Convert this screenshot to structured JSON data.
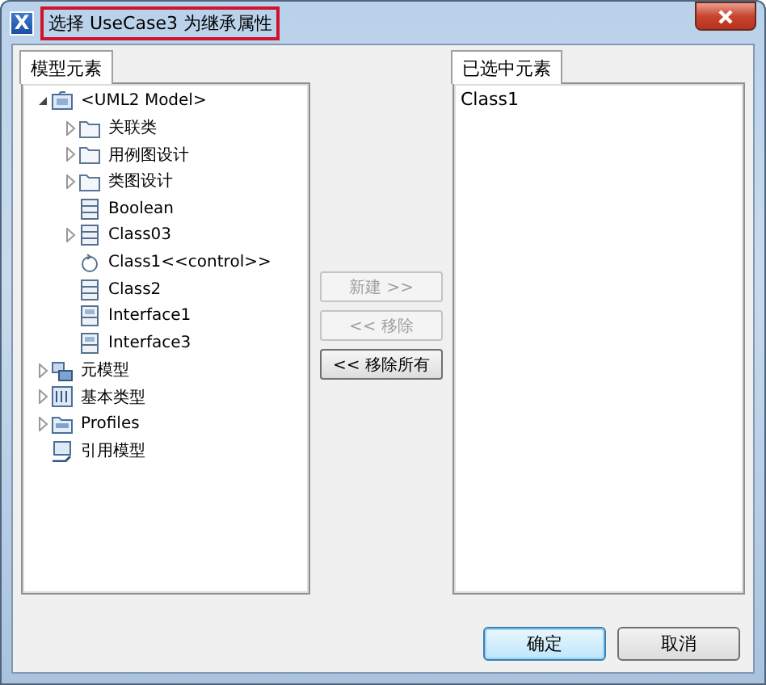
{
  "window": {
    "app_icon": "X",
    "title": "选择 UseCase3 为继承属性",
    "title_highlighted": true
  },
  "left_panel": {
    "tab": "模型元素",
    "tree": [
      {
        "label": "<UML2 Model>",
        "kind": "model",
        "expanded": true,
        "children": [
          {
            "label": "关联类",
            "kind": "folder",
            "expanded": false
          },
          {
            "label": "用例图设计",
            "kind": "folder",
            "expanded": false
          },
          {
            "label": "类图设计",
            "kind": "folder",
            "expanded": false
          },
          {
            "label": "Boolean",
            "kind": "class"
          },
          {
            "label": "Class03",
            "kind": "class",
            "expanded": false
          },
          {
            "label": "Class1<<control>>",
            "kind": "control"
          },
          {
            "label": "Class2",
            "kind": "class"
          },
          {
            "label": "Interface1",
            "kind": "interface"
          },
          {
            "label": "Interface3",
            "kind": "interface"
          }
        ]
      },
      {
        "label": "元模型",
        "kind": "metamodel",
        "expanded": false
      },
      {
        "label": "基本类型",
        "kind": "primitive",
        "expanded": false
      },
      {
        "label": "Profiles",
        "kind": "profiles",
        "expanded": false
      },
      {
        "label": "引用模型",
        "kind": "reference"
      }
    ]
  },
  "middle_buttons": [
    {
      "label": "新建 >>",
      "disabled": true
    },
    {
      "label": "<< 移除",
      "disabled": true
    },
    {
      "label": "<< 移除所有",
      "disabled": false
    }
  ],
  "right_panel": {
    "tab": "已选中元素",
    "items": [
      "Class1"
    ]
  },
  "buttons": [
    {
      "label": "确定",
      "default": true
    },
    {
      "label": "取消",
      "default": false
    }
  ]
}
